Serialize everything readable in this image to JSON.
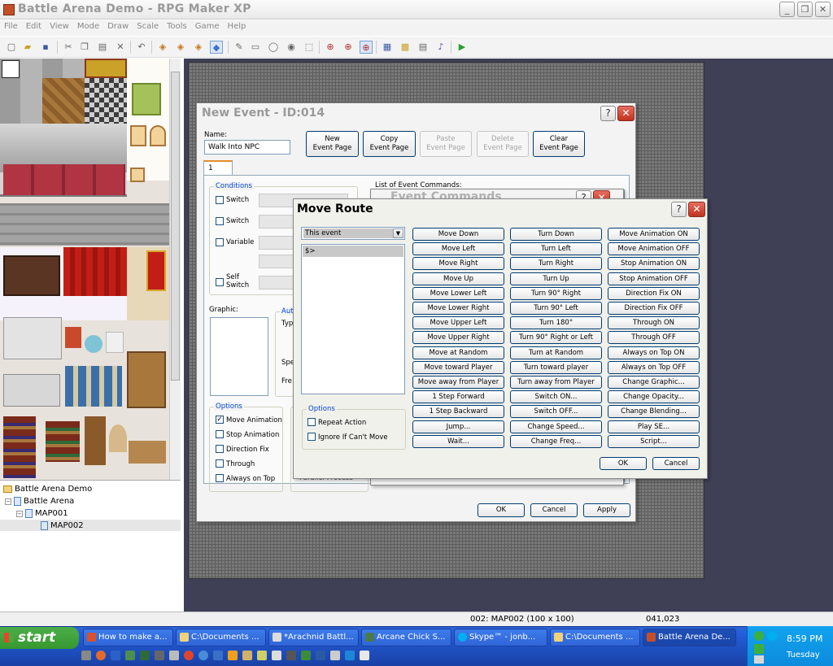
{
  "window": {
    "title": "Battle Arena Demo - RPG Maker XP",
    "menu": [
      "File",
      "Edit",
      "View",
      "Mode",
      "Draw",
      "Scale",
      "Tools",
      "Game",
      "Help"
    ]
  },
  "tree": {
    "root": "Battle Arena Demo",
    "project": "Battle Arena",
    "map1": "MAP001",
    "map2": "MAP002"
  },
  "status": {
    "map": "002: MAP002 (100 x 100)",
    "coords": "041,023"
  },
  "event_dialog": {
    "title": "New Event - ID:014",
    "name_label": "Name:",
    "name_value": "Walk Into NPC",
    "buttons": {
      "new_l1": "New",
      "new_l2": "Event Page",
      "copy_l1": "Copy",
      "copy_l2": "Event Page",
      "paste_l1": "Paste",
      "paste_l2": "Event Page",
      "delete_l1": "Delete",
      "delete_l2": "Event Page",
      "clear_l1": "Clear",
      "clear_l2": "Event Page"
    },
    "page_tab": "1",
    "conditions_label": "Conditions",
    "cond_switch1": "Switch",
    "cond_switch2": "Switch",
    "cond_variable": "Variable",
    "cond_self1": "Self",
    "cond_self2": "Switch",
    "list_label": "List of Event Commands:",
    "graphic_label": "Graphic:",
    "auto_label": "Aut",
    "typ_label": "Typ",
    "spe_label": "Spe",
    "fre_label": "Fre",
    "options_label": "Options",
    "opt_move_anim": "Move Animation",
    "opt_stop_anim": "Stop Animation",
    "opt_dir_fix": "Direction Fix",
    "opt_through": "Through",
    "opt_always_top": "Always on Top",
    "trigger_partial": "Parallel Process",
    "ok": "OK",
    "cancel": "Cancel",
    "apply": "Apply"
  },
  "event_commands_dialog": {
    "title": "Event Commands"
  },
  "move_route": {
    "title": "Move Route",
    "target_select": "This event",
    "list_item": "$>",
    "options_label": "Options",
    "repeat_action": "Repeat Action",
    "ignore_cant_move": "Ignore If Can't Move",
    "ok": "OK",
    "cancel": "Cancel",
    "col1": [
      "Move Down",
      "Move Left",
      "Move Right",
      "Move Up",
      "Move Lower Left",
      "Move Lower Right",
      "Move Upper Left",
      "Move Upper Right",
      "Move at Random",
      "Move toward Player",
      "Move away from Player",
      "1 Step Forward",
      "1 Step Backward",
      "Jump...",
      "Wait..."
    ],
    "col2": [
      "Turn Down",
      "Turn Left",
      "Turn Right",
      "Turn Up",
      "Turn 90° Right",
      "Turn 90° Left",
      "Turn 180°",
      "Turn 90° Right or Left",
      "Turn at Random",
      "Turn toward player",
      "Turn away from Player",
      "Switch ON...",
      "Switch OFF...",
      "Change Speed...",
      "Change Freq..."
    ],
    "col3": [
      "Move Animation ON",
      "Move Animation OFF",
      "Stop Animation ON",
      "Stop Animation OFF",
      "Direction Fix ON",
      "Direction Fix OFF",
      "Through ON",
      "Through OFF",
      "Always on Top ON",
      "Always on Top OFF",
      "Change Graphic...",
      "Change Opacity...",
      "Change Blending...",
      "Play SE...",
      "Script..."
    ]
  },
  "taskbar": {
    "start": "start",
    "tasks": [
      "How to make a...",
      "C:\\Documents ...",
      "*Arachnid Battl...",
      "Arcane Chick S...",
      "Skype™ - jonb...",
      "C:\\Documents ...",
      "Battle Arena De..."
    ],
    "time": "8:59 PM",
    "day": "Tuesday"
  }
}
